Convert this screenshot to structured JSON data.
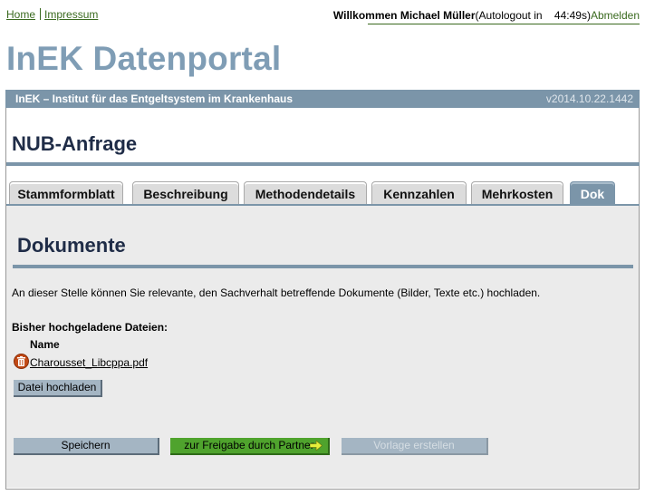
{
  "header": {
    "links": [
      {
        "label": "Home"
      },
      {
        "label": "Impressum"
      }
    ],
    "welcome": "Willkommen Michael Müller",
    "autologout": "(Autologout in",
    "timer": "44:49s)",
    "logout_label": "Abmelden"
  },
  "portal": {
    "title": "InEK Datenportal",
    "institute": "InEK – Institut für das Entgeltsystem im Krankenhaus",
    "version": "v2014.10.22.1442"
  },
  "page": {
    "title": "NUB-Anfrage"
  },
  "tabs": [
    {
      "label": "Stammformblatt",
      "active": false
    },
    {
      "label": "Beschreibung",
      "active": false
    },
    {
      "label": "Methodendetails",
      "active": false
    },
    {
      "label": "Kennzahlen",
      "active": false
    },
    {
      "label": "Mehrkosten",
      "active": false
    },
    {
      "label": "Dok",
      "active": true
    }
  ],
  "documents": {
    "title": "Dokumente",
    "intro": "An dieser Stelle können Sie relevante, den Sachverhalt betreffende Dokumente (Bilder, Texte etc.) hochladen.",
    "uploaded_label": "Bisher hochgeladene Dateien:",
    "name_header": "Name",
    "files": [
      {
        "name": "Charousset_Libcppa.pdf"
      }
    ],
    "upload_button": "Datei hochladen"
  },
  "actions": {
    "save": "Speichern",
    "release": "zur Freigabe durch Partner",
    "template": "Vorlage erstellen"
  },
  "colors": {
    "accent": "#7b95a9",
    "title": "#7f9db5",
    "link": "#3a6a1f",
    "release_button": "#4fa32d",
    "delete_icon": "#c24a16"
  }
}
